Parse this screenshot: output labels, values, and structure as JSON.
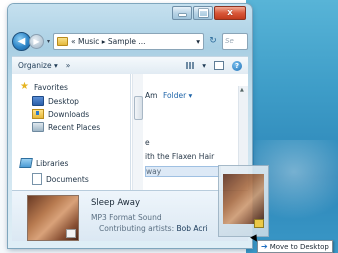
{
  "address": {
    "back_glyph": "◀",
    "forward_glyph": "▶",
    "dropdown_glyph": "▾",
    "breadcrumb": "« Music ▸ Sample ...",
    "dropdown": "▾",
    "refresh_glyph": "↻",
    "search_placeholder": "Se"
  },
  "toolbar": {
    "organize": "Organize ▾",
    "overflow": "»",
    "views_drop": "▾",
    "help": "?"
  },
  "navigation": {
    "favorites": "Favorites",
    "desktop": "Desktop",
    "downloads": "Downloads",
    "recent_places": "Recent Places",
    "libraries": "Libraries",
    "documents": "Documents"
  },
  "file_list": {
    "column_am": "Am",
    "column_folder": "Folder ▾",
    "row_1": "e",
    "row_2": "ith the Flaxen Hair",
    "row_3": "way"
  },
  "details": {
    "title": "Sleep Away",
    "type": "MP3 Format Sound",
    "artist_label": "Contributing artists:",
    "artist": "Bob Acri"
  },
  "drag": {
    "tooltip_arrow": "➔",
    "tooltip_text": "Move to Desktop"
  },
  "window_controls": {
    "close": "x"
  },
  "colors": {
    "desktop": "#3e9dc8",
    "accent": "#1f6fc2"
  }
}
